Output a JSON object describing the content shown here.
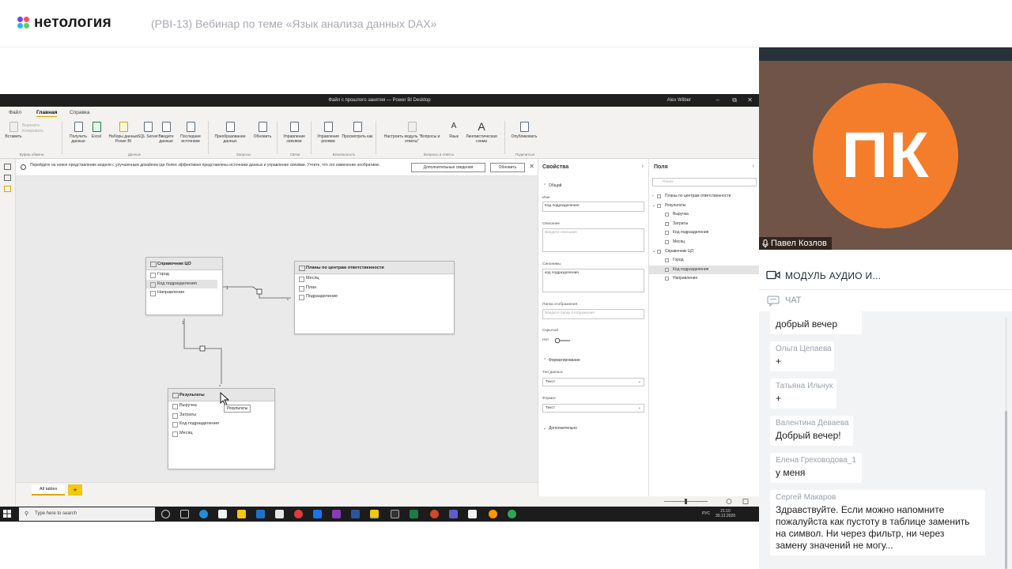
{
  "brand": {
    "logo_text": "нетология",
    "dot_colors": [
      "#7b3ff2",
      "#ff4e5c",
      "#1fb7ff",
      "#5bd15b"
    ]
  },
  "webinar_title": "(PBI-13) Вебинар по теме «Язык анализа данных DAX»",
  "pbi": {
    "window_title": "Файл с прошлого занятия — Power BI Desktop",
    "user": "Alex Wilber",
    "tabs": [
      "Файл",
      "Главная",
      "Справка"
    ],
    "ribbon": {
      "paste": "Вставить",
      "cut": "Вырезать",
      "copy": "Копировать",
      "get_data": "Получить данные",
      "excel": "Excel",
      "datasets": "Наборы данных Power BI",
      "sql": "SQL Server",
      "enter_data": "Введите данные",
      "recent": "Последние источники",
      "transform": "Преобразование данных",
      "refresh": "Обновить",
      "manage_rel": "Управление связями",
      "manage_roles": "Управление ролями",
      "view_as": "Просмотреть как",
      "qa": "Настроить модуль \"Вопросы и ответы\"",
      "language": "Язык",
      "ling": "Лингвистическая схема",
      "publish": "Опубликовать",
      "groups": {
        "clipboard": "Буфер обмена",
        "data": "Данные",
        "queries": "Запросы",
        "relations": "Связи",
        "security": "Безопасность",
        "qa": "Вопросы и ответы",
        "share": "Поделиться"
      }
    },
    "info_text": "Перейдите на новое представление модели с улучшенным дизайном где более эффективно представлены источники данных и управление связями. Учтите, что это изменение необратимо.",
    "info_more": "Дополнительные сведения",
    "info_update": "Обновить",
    "tables": [
      {
        "title": "Справочник ЦО",
        "fields": [
          "Город",
          "Код подразделения",
          "Направление"
        ]
      },
      {
        "title": "Планы по центрам ответственности",
        "fields": [
          "Месяц",
          "План",
          "Подразделение"
        ]
      },
      {
        "title": "Результаты",
        "fields": [
          "Выручка",
          "Затраты",
          "Код подразделения",
          "Месяц"
        ]
      }
    ],
    "relation_labels": [
      "1",
      "*",
      "1",
      "*"
    ],
    "tooltip": "Результаты",
    "bottom_tab": "All tables",
    "properties": {
      "title": "Свойства",
      "general": "Общий",
      "name_label": "Имя",
      "name_value": "Код подразделения",
      "desc_label": "Описание",
      "desc_placeholder": "Введите описание",
      "syn_label": "Синонимы",
      "syn_value": "код подразделения",
      "folder_label": "Папка отображения",
      "folder_placeholder": "Введите папку отображения",
      "hidden_label": "Скрытый",
      "hidden_value": "Нет",
      "format_section": "Форматирование",
      "dtype_label": "Тип данных",
      "dtype_value": "Текст",
      "format_label": "Формат",
      "format_value": "Текст",
      "advanced": "Дополнительно"
    },
    "fields_pane": {
      "title": "Поля",
      "search_placeholder": "Поиск",
      "items": [
        {
          "label": "Планы по центрам ответственности",
          "level": 0
        },
        {
          "label": "Результаты",
          "level": 0
        },
        {
          "label": "Выручка",
          "level": 1
        },
        {
          "label": "Затраты",
          "level": 1
        },
        {
          "label": "Код подразделения",
          "level": 1
        },
        {
          "label": "Месяц",
          "level": 1
        },
        {
          "label": "Справочник ЦО",
          "level": 0
        },
        {
          "label": "Город",
          "level": 1
        },
        {
          "label": "Код подразделения",
          "level": 1,
          "selected": true
        },
        {
          "label": "Направление",
          "level": 1
        }
      ]
    },
    "taskbar": {
      "search": "Type here to search",
      "lang": "РУС",
      "time": "21:10",
      "date": "30.12.2020"
    }
  },
  "presenter": {
    "initials": "ПК",
    "name": "Павел Козлов",
    "avatar_color": "#f47d2b"
  },
  "module_label": "МОДУЛЬ АУДИО И...",
  "chat_label": "ЧАТ",
  "chat": [
    {
      "author": "",
      "text": "добрый вечер"
    },
    {
      "author": "Ольга Цепаева",
      "text": "+"
    },
    {
      "author": "Татьяна Ильчук",
      "text": "+"
    },
    {
      "author": "Валентина Деваева",
      "text": "Добрый вечер!"
    },
    {
      "author": "Елена Греховодова_1",
      "text": "у меня"
    },
    {
      "author": "Сергей Макаров",
      "lines": [
        "Здравствуйте. Если можно напомните",
        "пожалуйста как пустоту в таблице заменить",
        "на символ. Ни через фильтр, ни через",
        "замену значений не могу..."
      ]
    }
  ]
}
